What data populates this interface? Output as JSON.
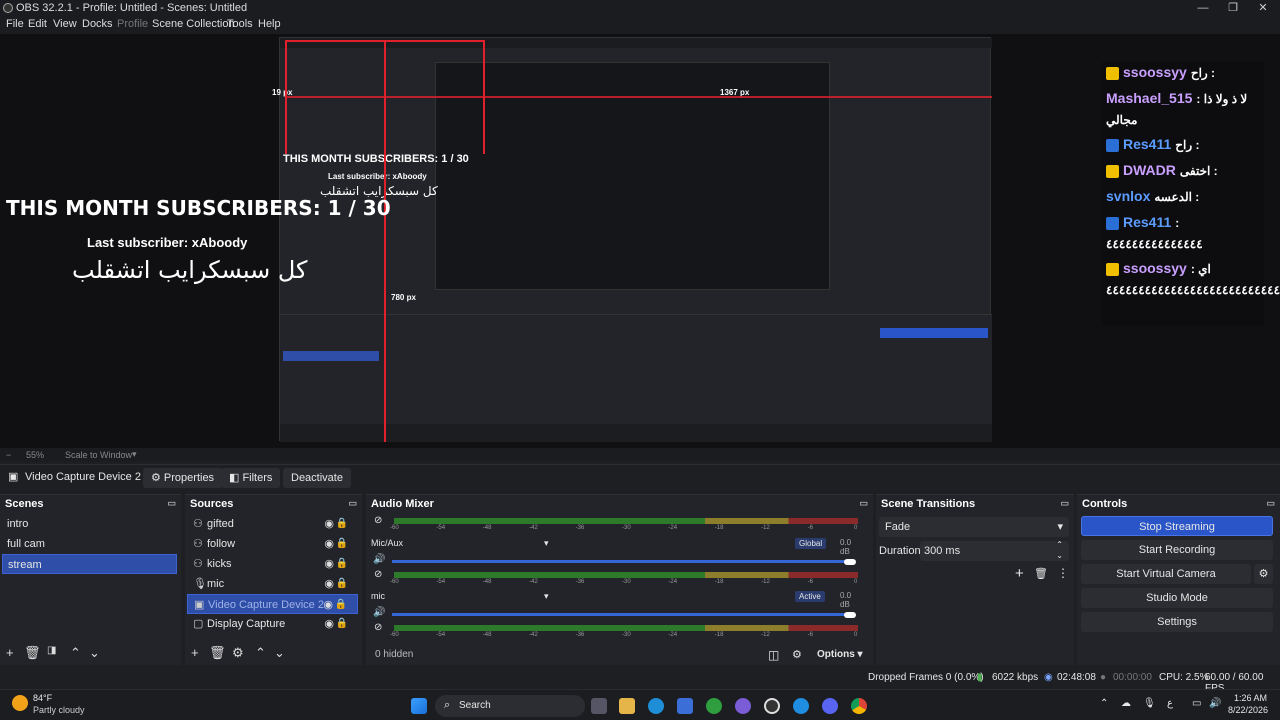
{
  "window": {
    "title": "OBS 32.2.1 - Profile: Untitled - Scenes: Untitled"
  },
  "menu": [
    "File",
    "Edit",
    "View",
    "Docks",
    "Profile",
    "Scene Collection",
    "Tools",
    "Help"
  ],
  "preview": {
    "overlay_title": "THIS MONTH SUBSCRIBERS: 1 / 30",
    "overlay_last": "Last subscriber: xAboody",
    "overlay_arabic": "كل سبسكرايب اتشقلب",
    "nested_title": "THIS MONTH SUBSCRIBERS: 1 / 30",
    "nested_last": "Last subscriber: xAboody",
    "nested_arabic": "كل سبسكرايب اتشقلب",
    "dim_19": "19 px",
    "dim_780": "780 px",
    "dim_1367": "1367 px",
    "chat": [
      {
        "user": "ssoossyy",
        "msg": "راح :",
        "color": "#f0c000",
        "user_color": "#c9a0ff"
      },
      {
        "user": "Mashael_515",
        "msg": "لا ذ ولا ذا : مجالي",
        "color": "",
        "user_color": "#c9a0ff"
      },
      {
        "user": "Res411",
        "msg": "راح :",
        "color": "#2a6fd6",
        "user_color": "#5b9cff"
      },
      {
        "user": "DWADR",
        "msg": "اختفى :",
        "color": "#f0c000",
        "user_color": "#c9a0ff"
      },
      {
        "user": "svnlox",
        "msg": "الدعسه :",
        "color": "",
        "user_color": "#5b9cff"
      },
      {
        "user": "Res411",
        "msg": ": ٤٤٤٤٤٤٤٤٤٤٤٤٤٤٤",
        "color": "#2a6fd6",
        "user_color": "#5b9cff"
      },
      {
        "user": "ssoossyy",
        "msg": "اي : ٤٤٤٤٤٤٤٤٤٤٤٤٤٤٤٤٤٤٤٤٤٤٤٤٤٤٤٤٤",
        "color": "#f0c000",
        "user_color": "#c9a0ff"
      }
    ]
  },
  "zoom": {
    "level": "55%",
    "mode": "Scale to Window"
  },
  "source_toolbar": {
    "source_name": "Video Capture Device 2",
    "properties": "Properties",
    "filters": "Filters",
    "deactivate": "Deactivate"
  },
  "scenes": {
    "title": "Scenes",
    "items": [
      {
        "label": "intro"
      },
      {
        "label": "full cam"
      },
      {
        "label": "stream"
      }
    ],
    "selected": 2
  },
  "sources": {
    "title": "Sources",
    "items": [
      {
        "label": "gifted"
      },
      {
        "label": "follow"
      },
      {
        "label": "kicks"
      },
      {
        "label": "mic"
      },
      {
        "label": "Video Capture Device 2"
      },
      {
        "label": "Display Capture"
      }
    ],
    "selected": 4
  },
  "mixer": {
    "title": "Audio Mixer",
    "ticks": [
      "-60",
      "-54",
      "-48",
      "-42",
      "-36",
      "-30",
      "-24",
      "-18",
      "-12",
      "-6",
      "0"
    ],
    "channels": [
      {
        "name": "Mic/Aux",
        "badge": "Global",
        "db": "0.0 dB",
        "level": 1.0
      },
      {
        "name": "mic",
        "badge": "Active",
        "db": "0.0 dB",
        "level": 1.0
      }
    ],
    "hidden": "0 hidden",
    "options": "Options"
  },
  "transitions": {
    "title": "Scene Transitions",
    "type": "Fade",
    "duration_label": "Duration",
    "duration_value": "300 ms"
  },
  "controls": {
    "title": "Controls",
    "stop_streaming": "Stop Streaming",
    "start_recording": "Start Recording",
    "start_virtual_camera": "Start Virtual Camera",
    "studio_mode": "Studio Mode",
    "settings": "Settings"
  },
  "status": {
    "dropped": "Dropped Frames 0 (0.0%)",
    "bitrate": "6022 kbps",
    "stream_time": "02:48:08",
    "rec_time": "00:00:00",
    "cpu": "CPU: 2.5%",
    "fps": "60.00 / 60.00 FPS"
  },
  "taskbar": {
    "weather_temp": "84°F",
    "weather_desc": "Partly cloudy",
    "search": "Search",
    "time": "1:26 AM",
    "date": "8/22/2026"
  },
  "colors": {
    "accent": "#2f4ea8",
    "stream_button": "#2a55c8",
    "live_line": "#e0202a"
  }
}
